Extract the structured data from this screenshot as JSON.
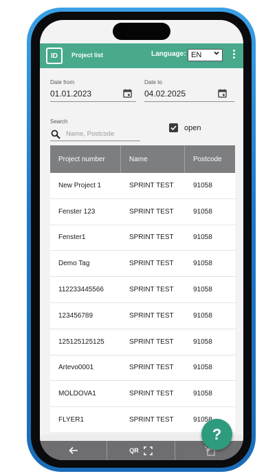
{
  "header": {
    "title": "Project list",
    "language_label": "Language:",
    "language_value": "EN"
  },
  "filters": {
    "date_from": {
      "label": "Date from",
      "value": "01.01.2023"
    },
    "date_to": {
      "label": "Date to",
      "value": "04.02.2025"
    },
    "search": {
      "label": "Search",
      "placeholder": "Name, Postcode"
    },
    "open": {
      "label": "open",
      "checked": true
    }
  },
  "table": {
    "columns": [
      "Project number",
      "Name",
      "Postcode"
    ],
    "rows": [
      [
        "New Project 1",
        "SPRINT TEST",
        "91058"
      ],
      [
        "Fenster 123",
        "SPRINT TEST",
        "91058"
      ],
      [
        "Fenster1",
        "SPRINT TEST",
        "91058"
      ],
      [
        "Demo Tag",
        "SPRINT TEST",
        "91058"
      ],
      [
        "112233445566",
        "SPRINT TEST",
        "91058"
      ],
      [
        "123456789",
        "SPRINT TEST",
        "91058"
      ],
      [
        "125125125125",
        "SPRINT TEST",
        "91058"
      ],
      [
        "Artevo0001",
        "SPRINT TEST",
        "91058"
      ],
      [
        "MOLDOVA1",
        "SPRINT TEST",
        "91058"
      ],
      [
        "FLYER1",
        "SPRINT TEST",
        "91058"
      ]
    ]
  },
  "bottom_bar": {
    "back_icon": "arrow-left-icon",
    "qr_label": "QR",
    "qr_icon": "scan-frame-icon",
    "import_icon": "import-icon"
  },
  "help": {
    "label": "?"
  },
  "colors": {
    "brand": "#48a98d",
    "fab": "#2f9b7e",
    "table_header": "#7d7e80",
    "bottom_bar": "#6e6e70",
    "frame": "#1e78c8"
  }
}
